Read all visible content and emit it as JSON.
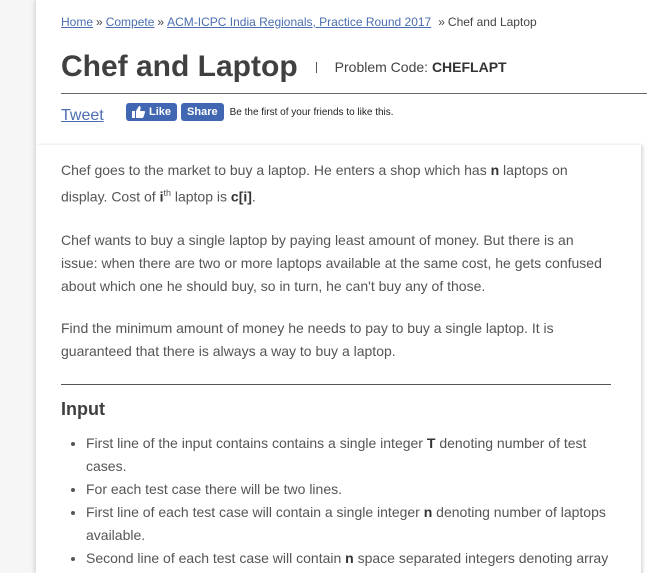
{
  "breadcrumb": {
    "home": "Home",
    "compete": "Compete",
    "contest": "ACM-ICPC India Regionals, Practice Round 2017",
    "current": "Chef and Laptop",
    "sep": "»"
  },
  "problem": {
    "title": "Chef and Laptop",
    "code_label": "Problem Code:",
    "code": "CHEFLAPT"
  },
  "social": {
    "tweet": "Tweet",
    "like": "Like",
    "share": "Share",
    "friends_text": "Be the first of your friends to like this."
  },
  "statement": {
    "p1_a": "Chef goes to the market to buy a laptop. He enters a shop which has ",
    "p1_n": "n",
    "p1_b": " laptops on display. Cost of ",
    "p1_i": "i",
    "p1_th": "th",
    "p1_c": " laptop is ",
    "p1_ci": "c[i]",
    "p1_end": ".",
    "p2": "Chef wants to buy a single laptop by paying least amount of money. But there is an issue: when there are two or more laptops available at the same cost, he gets confused about which one he should buy, so in turn, he can't buy any of those.",
    "p3": "Find the minimum amount of money he needs to pay to buy a single laptop. It is guaranteed that there is always a way to buy a laptop."
  },
  "input_section": {
    "heading": "Input",
    "b1_a": "First line of the input contains contains a single integer ",
    "b1_t": "T",
    "b1_b": " denoting number of test cases.",
    "b2": "For each test case there will be two lines.",
    "b3_a": "First line of each test case will contain a single integer ",
    "b3_n": "n",
    "b3_b": " denoting number of laptops available.",
    "b4_a": "Second line of each test case will contain ",
    "b4_n": "n",
    "b4_b": " space separated integers denoting array"
  }
}
